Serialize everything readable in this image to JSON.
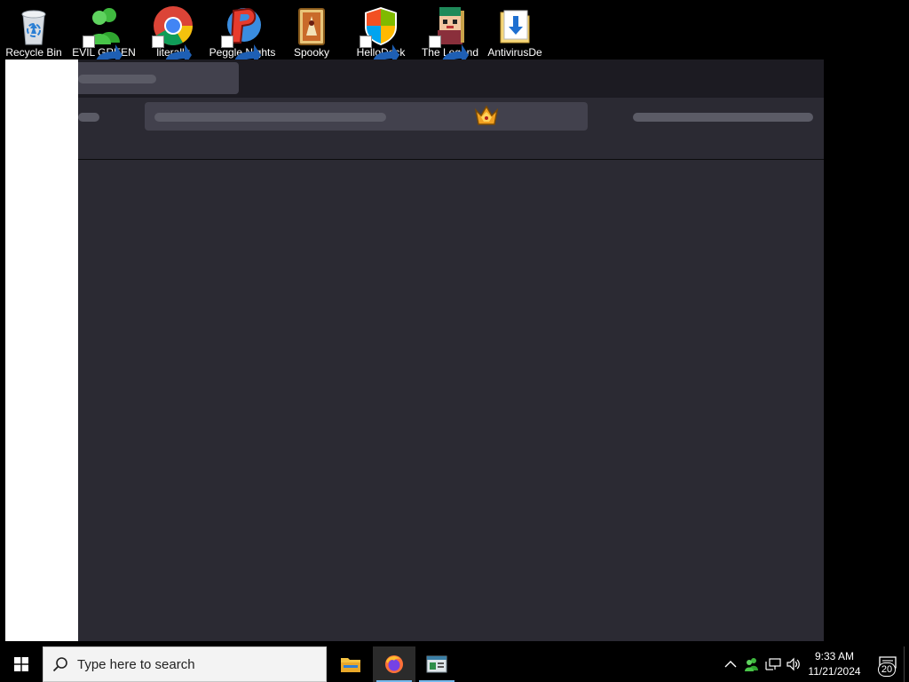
{
  "desktop": {
    "icons": [
      {
        "label": "Recycle Bin",
        "icon": "recycle-bin-icon"
      },
      {
        "label": "EVIL GREEN",
        "icon": "messenger-people-icon"
      },
      {
        "label": "literally",
        "icon": "chrome-icon"
      },
      {
        "label": "Peggle Nights",
        "icon": "peggle-icon"
      },
      {
        "label": "Spooky",
        "icon": "game-card-icon"
      },
      {
        "label": "HelloDock",
        "icon": "windows-shield-icon"
      },
      {
        "label": "The Legend",
        "icon": "pixel-character-icon"
      },
      {
        "label": "AntivirusDe",
        "icon": "download-file-icon"
      }
    ]
  },
  "browser": {
    "state": "loading-skeleton",
    "colors": {
      "frame": "#1c1b22",
      "toolbar": "#2b2a33",
      "urlbar": "#42414d",
      "placeholder": "#5b5b66"
    }
  },
  "taskbar": {
    "search_placeholder": "Type here to search",
    "apps": [
      {
        "name": "File Explorer",
        "icon": "folder-icon"
      },
      {
        "name": "Firefox",
        "icon": "firefox-icon",
        "active": true
      },
      {
        "name": "Console window",
        "icon": "console-window-icon"
      }
    ],
    "tray": {
      "icons": [
        "chevron-up-icon",
        "people-tray-icon",
        "network-icon",
        "volume-icon"
      ]
    },
    "clock": {
      "time": "9:33 AM",
      "date": "11/21/2024"
    },
    "notifications_count": "20"
  }
}
